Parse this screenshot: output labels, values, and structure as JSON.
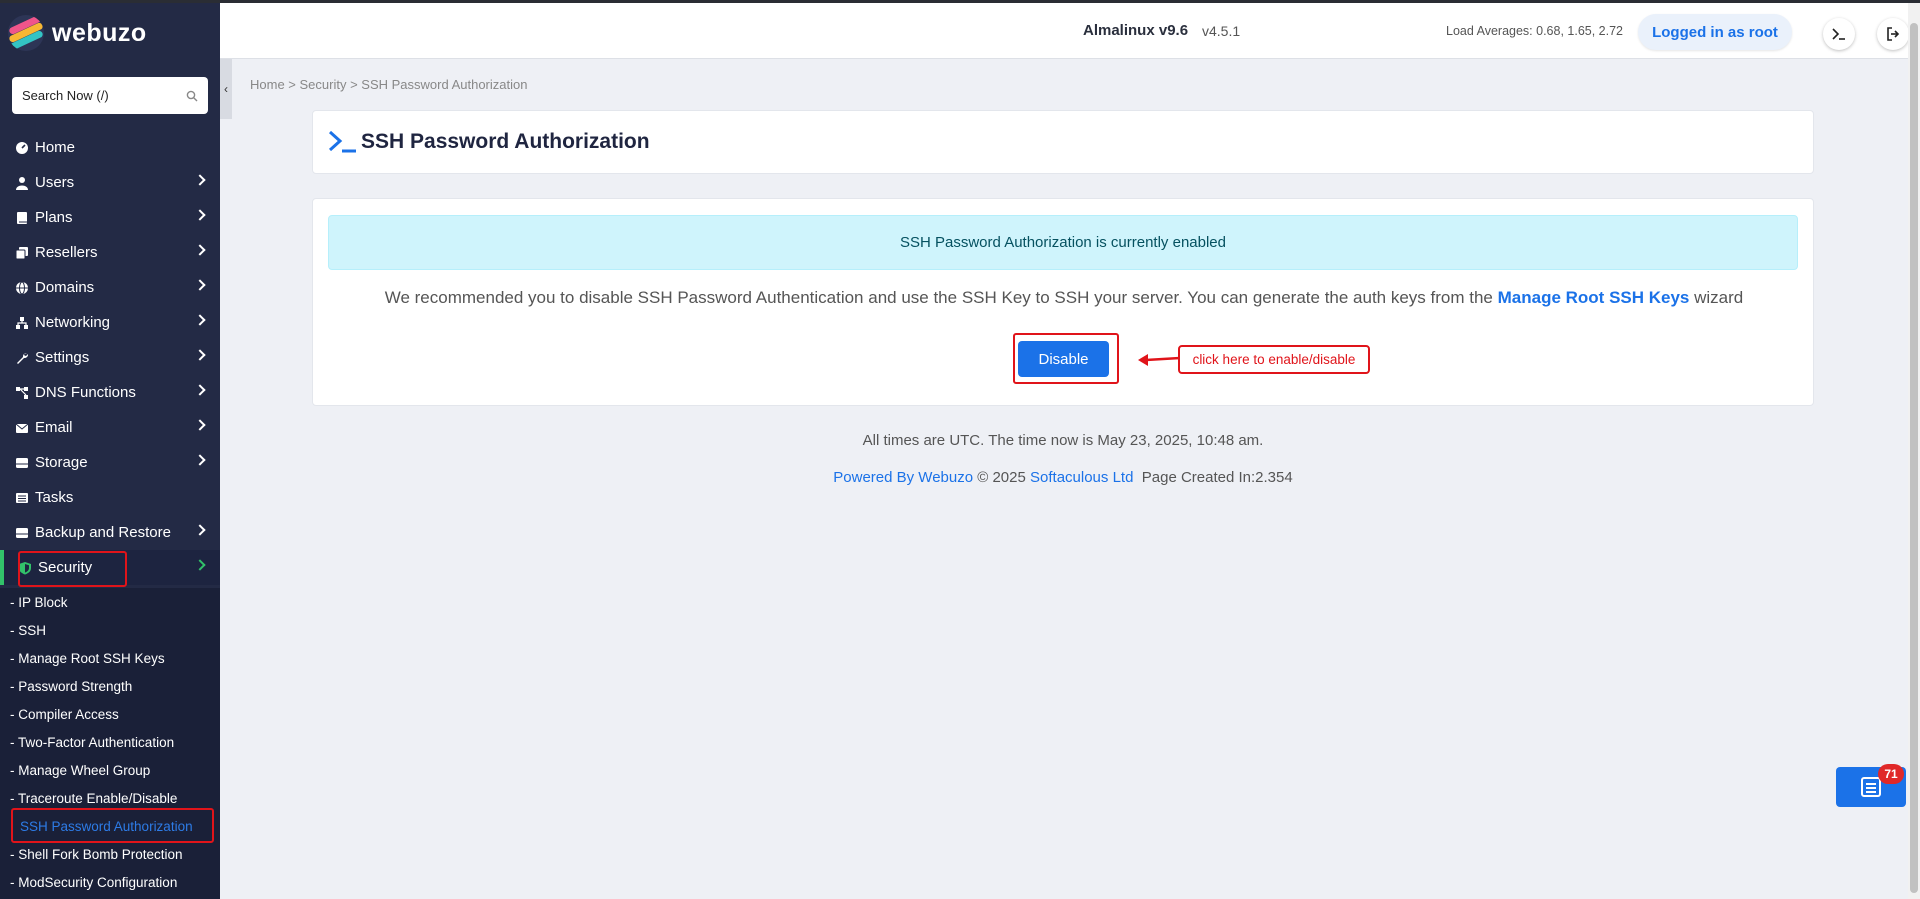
{
  "app": {
    "logo_text": "webuzo"
  },
  "search": {
    "placeholder": "Search Now (/)"
  },
  "sidebar": {
    "items": [
      {
        "label": "Home",
        "icon": "dashboard-icon",
        "chevron": false
      },
      {
        "label": "Users",
        "icon": "user-icon",
        "chevron": true
      },
      {
        "label": "Plans",
        "icon": "book-icon",
        "chevron": true
      },
      {
        "label": "Resellers",
        "icon": "copy-icon",
        "chevron": true
      },
      {
        "label": "Domains",
        "icon": "globe-icon",
        "chevron": true
      },
      {
        "label": "Networking",
        "icon": "network-icon",
        "chevron": true
      },
      {
        "label": "Settings",
        "icon": "wrench-icon",
        "chevron": true
      },
      {
        "label": "DNS Functions",
        "icon": "sitemap-icon",
        "chevron": true
      },
      {
        "label": "Email",
        "icon": "envelope-icon",
        "chevron": true
      },
      {
        "label": "Storage",
        "icon": "hdd-icon",
        "chevron": true
      },
      {
        "label": "Tasks",
        "icon": "list-icon",
        "chevron": false
      },
      {
        "label": "Backup and Restore",
        "icon": "hdd-icon",
        "chevron": true
      },
      {
        "label": "Security",
        "icon": "shield-icon",
        "chevron": true,
        "active": true
      }
    ],
    "security_sub": [
      "- IP Block",
      "- SSH",
      "- Manage Root SSH Keys",
      "- Password Strength",
      "- Compiler Access",
      "- Two-Factor Authentication",
      "- Manage Wheel Group",
      "- Traceroute Enable/Disable",
      "SSH Password Authorization",
      "- Shell Fork Bomb Protection",
      "- ModSecurity Configuration"
    ]
  },
  "header": {
    "os_name": "Almalinux v9.6",
    "version": "v4.5.1",
    "load_averages": "Load Averages: 0.68, 1.65, 2.72",
    "logged_in": "Logged in as root"
  },
  "breadcrumb": "Home > Security > SSH Password Authorization",
  "page": {
    "title": "SSH Password Authorization",
    "alert": "SSH Password Authorization is currently enabled",
    "recommend_text": "We recommended you to disable SSH Password Authentication and use the SSH Key to SSH your server. You can generate the auth keys from the",
    "recommend_link": "Manage Root SSH Keys",
    "recommend_suffix": "wizard",
    "button_label": "Disable",
    "annotation": "click here to enable/disable"
  },
  "footer": {
    "time_note": "All times are UTC. The time now is May 23, 2025, 10:48 am.",
    "powered": "Powered By Webuzo",
    "copyright": "© 2025",
    "company": "Softaculous Ltd",
    "page_created": "Page Created In:2.354"
  },
  "notifications": {
    "count": "71"
  },
  "colors": {
    "accent": "#1b72e8",
    "sidebar": "#232a45",
    "active_marker": "#32c26a",
    "annotation_red": "#e0141a"
  }
}
